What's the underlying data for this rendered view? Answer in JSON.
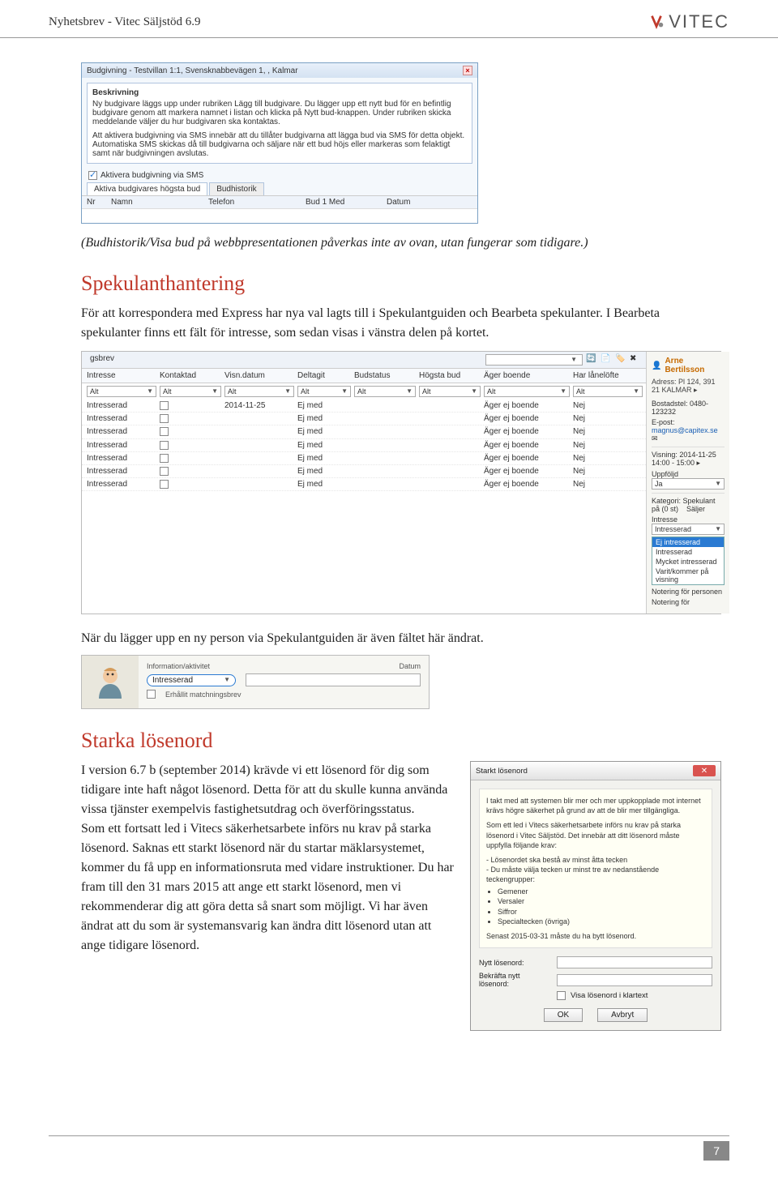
{
  "header": {
    "title": "Nyhetsbrev - Vitec Säljstöd 6.9",
    "logo": "VITEC"
  },
  "bud_dialog": {
    "title": "Budgivning - Testvillan 1:1, Svensknabbevägen 1, , Kalmar",
    "beskrivning_label": "Beskrivning",
    "beskrivning_p1": "Ny budgivare läggs upp under rubriken Lägg till budgivare. Du lägger upp ett nytt bud för en befintlig budgivare genom att markera namnet i listan och klicka på Nytt bud-knappen. Under rubriken skicka meddelande väljer du hur budgivaren ska kontaktas.",
    "beskrivning_p2": "Att aktivera budgivning via SMS innebär att du tillåter budgivarna att lägga bud via SMS för detta objekt. Automatiska SMS skickas då till budgivarna och säljare när ett bud höjs eller markeras som felaktigt samt när budgivningen avslutas.",
    "checkbox": "Aktivera budgivning via SMS",
    "tab_active": "Aktiva budgivares högsta bud",
    "tab_inactive": "Budhistorik",
    "grid_cols": [
      "Nr",
      "Namn",
      "Telefon",
      "Bud 1 Med",
      "Datum"
    ]
  },
  "bud_note": "(Budhistorik/Visa bud på webbpresentationen påverkas inte av ovan, utan fungerar som tidigare.)",
  "spekulant": {
    "heading": "Spekulanthantering",
    "para": "För att korrespondera med Express har nya val lagts till i Spekulantguiden och Bearbeta spekulanter. I Bearbeta spekulanter finns ett fält för intresse, som sedan visas i vänstra delen på kortet.",
    "tab_label": "gsbrev",
    "filter_value": "Alt",
    "columns": [
      "Intresse",
      "Kontaktad",
      "Visn.datum",
      "Deltagit",
      "Budstatus",
      "Högsta bud",
      "Äger boende",
      "Har lånelöfte"
    ],
    "row": {
      "intresse": "Intresserad",
      "kontaktad": "",
      "visn": "2014-11-25",
      "deltagit": "Ej med",
      "budstatus": "",
      "hogsta": "",
      "ager": "Äger ej boende",
      "lane": "Nej"
    },
    "row_alt": {
      "intresse": "Intresserad",
      "kontaktad": "",
      "visn": "",
      "deltagit": "Ej med",
      "budstatus": "",
      "hogsta": "",
      "ager": "Äger ej boende",
      "lane": "Nej"
    },
    "right": {
      "name": "Arne Bertilsson",
      "address": "Adress: Pl 124, 391 21  KALMAR  ▸",
      "phone": "Bostadstel: 0480-123232",
      "email_label": "E-post:",
      "email": "magnus@capitex.se",
      "visning": "Visning: 2014-11-25 14:00 - 15:00  ▸",
      "uppfoljd_label": "Uppföljd",
      "uppfoljd_value": "Ja",
      "kategori": "Kategori: Spekulant på (0 st)",
      "saljer": "Säljer",
      "intresse_label": "Intresse",
      "intresse_value": "Intresserad",
      "notering1": "Notering för personen",
      "notering2": "Notering för",
      "dropdown": [
        "Ej intresserad",
        "Intresserad",
        "Mycket intresserad",
        "Varit/kommer på visning"
      ]
    },
    "after_para": "När du lägger upp en ny person via Spekulantguiden är även fältet här ändrat."
  },
  "info_shot": {
    "col1": "Information/aktivitet",
    "col2": "Datum",
    "value": "Intresserad",
    "check_label": "Erhållit matchningsbrev"
  },
  "starka": {
    "heading": "Starka lösenord",
    "para": "I version 6.7 b (september 2014) krävde vi ett lösenord för dig som tidigare inte haft något lösenord. Detta för att du skulle kunna använda vissa tjänster exempelvis fastighetsutdrag och överföringsstatus.\nSom ett fortsatt led i Vitecs säkerhetsarbete införs nu krav på starka lösenord. Saknas ett starkt lösenord när du startar mäklarsystemet, kommer du få upp en informationsruta med vidare instruktioner. Du har fram till den 31 mars 2015 att ange ett starkt lösenord, men vi rekommenderar dig att göra detta så snart som möjligt. Vi har även ändrat att du som är systemansvarig kan ändra ditt lösenord utan att ange tidigare lösenord."
  },
  "pwd_dialog": {
    "title": "Starkt lösenord",
    "intro": "I takt med att systemen blir mer och mer uppkopplade mot internet krävs högre säkerhet på grund av att de blir mer tillgängliga.",
    "lead": "Som ett led i Vitecs säkerhetsarbete införs nu krav på starka lösenord i Vitec Säljstöd. Det innebär att ditt lösenord måste uppfylla följande krav:",
    "rules_header": "- Lösenordet ska bestå av minst åtta tecken",
    "rules_sub": "- Du måste välja tecken ur minst tre av nedanstående teckengrupper:",
    "rules": [
      "Gemener",
      "Versaler",
      "Siffror",
      "Specialtecken (övriga)"
    ],
    "deadline": "Senast 2015-03-31 måste du ha bytt lösenord.",
    "field_new": "Nytt lösenord:",
    "field_confirm": "Bekräfta nytt lösenord:",
    "check_show": "Visa lösenord i klartext",
    "btn_ok": "OK",
    "btn_cancel": "Avbryt"
  },
  "page_number": "7"
}
